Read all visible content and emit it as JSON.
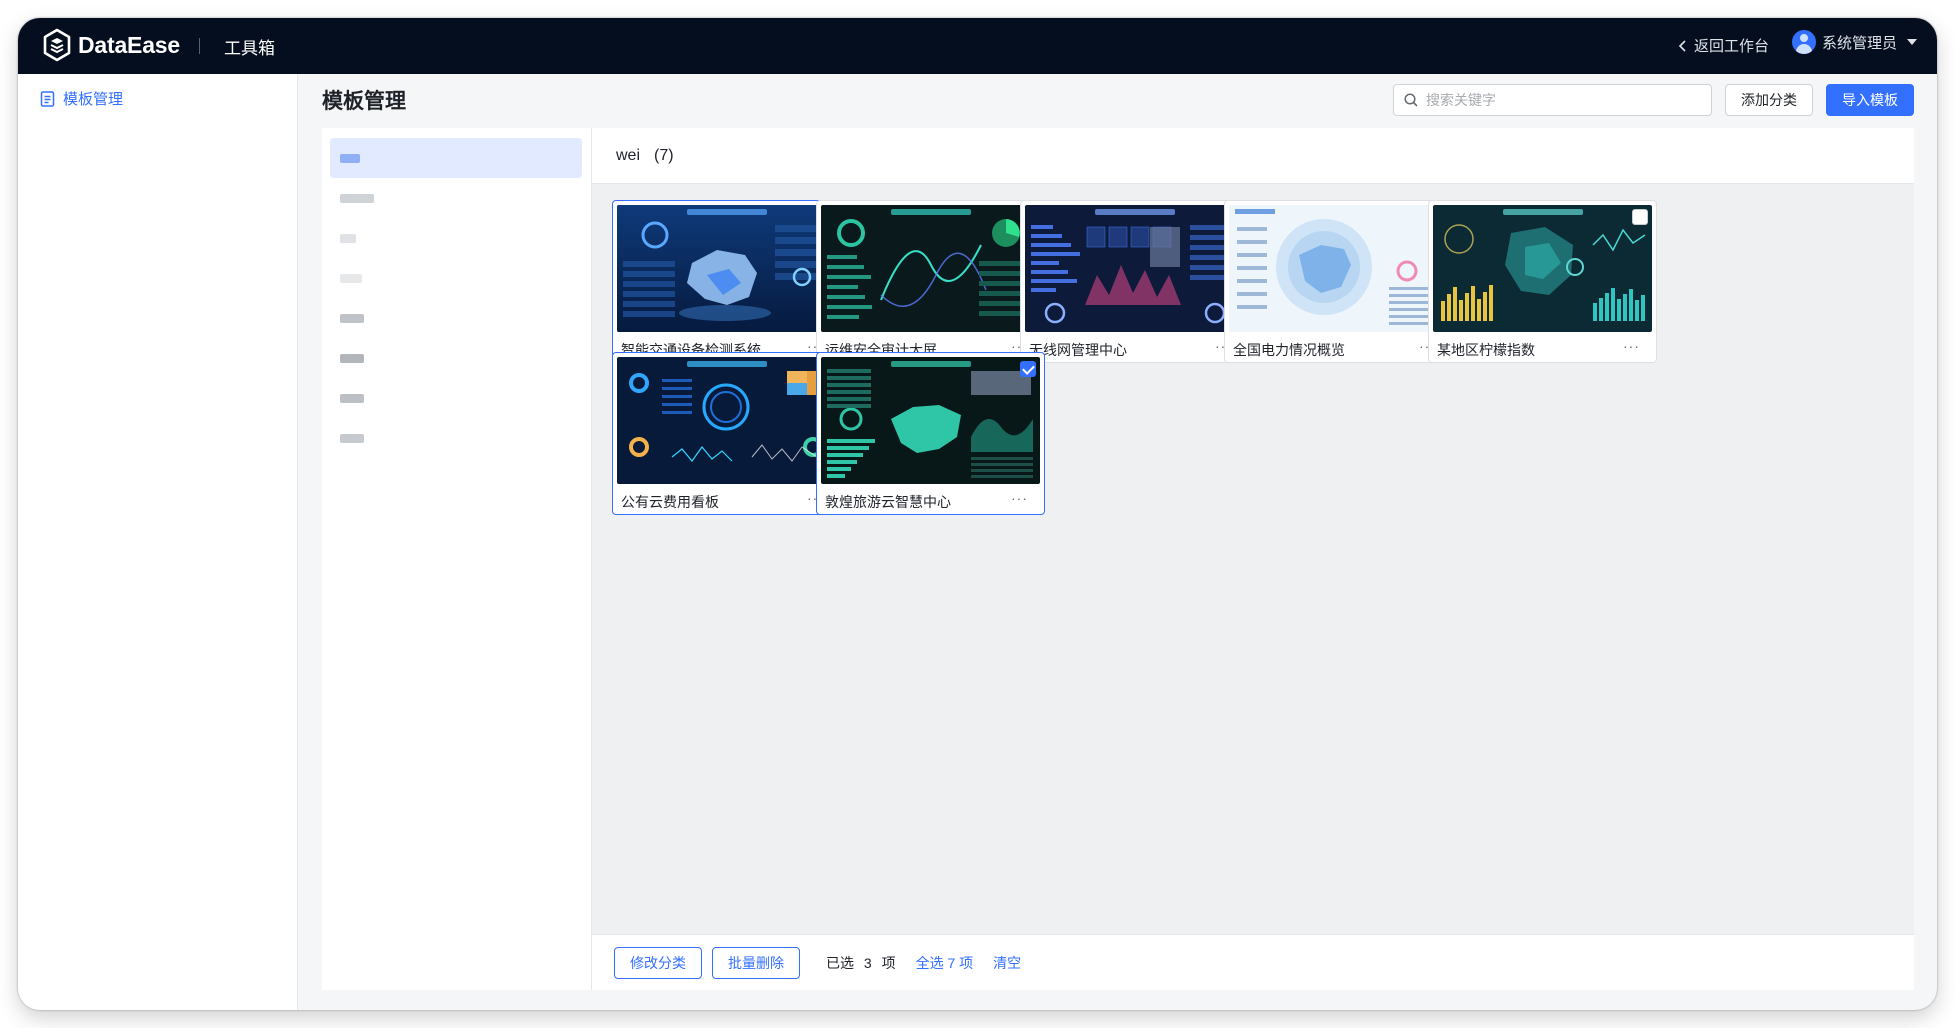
{
  "header": {
    "logo_text": "DataEase",
    "section": "工具箱",
    "back_label": "返回工作台",
    "user_name": "系统管理员"
  },
  "sidebar": {
    "items": [
      {
        "label": "模板管理",
        "icon": "template-doc-icon",
        "active": true
      }
    ]
  },
  "main": {
    "title": "模板管理",
    "search_placeholder": "搜索关键字",
    "add_category_label": "添加分类",
    "import_label": "导入模板"
  },
  "categories": [
    {
      "label": "",
      "active": true,
      "shade": "#8fb0f7"
    },
    {
      "label": "",
      "shade": "#cfd2d6"
    },
    {
      "label": "",
      "shade": "#e0e2e5"
    },
    {
      "label": "",
      "shade": "#e6e8ea"
    },
    {
      "label": "",
      "shade": "#bfc2c6"
    },
    {
      "label": "",
      "shade": "#b2b5b9"
    },
    {
      "label": "",
      "shade": "#bcbfc3"
    },
    {
      "label": "",
      "shade": "#c6c9cd"
    }
  ],
  "group": {
    "name": "wei",
    "count": "(7)"
  },
  "templates": [
    {
      "name": "智能交通设备检测系统",
      "checked": true,
      "theme": "traffic"
    },
    {
      "name": "运维安全审计大屏",
      "checked": false,
      "theme": "ops"
    },
    {
      "name": "无线网管理中心",
      "checked": false,
      "theme": "wireless"
    },
    {
      "name": "全国电力情况概览",
      "checked": false,
      "theme": "power"
    },
    {
      "name": "某地区柠檬指数",
      "checked": false,
      "theme": "lemon"
    },
    {
      "name": "公有云费用看板",
      "checked": true,
      "theme": "cloud"
    },
    {
      "name": "敦煌旅游云智慧中心",
      "checked": true,
      "theme": "travel"
    }
  ],
  "more_label": "···",
  "footer": {
    "edit_category_label": "修改分类",
    "batch_delete_label": "批量删除",
    "selected_prefix": "已选",
    "selected_count": "3",
    "selected_suffix": "项",
    "select_all_label": "全选 7 项",
    "clear_label": "清空"
  },
  "colors": {
    "accent": "#3370ff",
    "topbar": "#050e1f"
  }
}
